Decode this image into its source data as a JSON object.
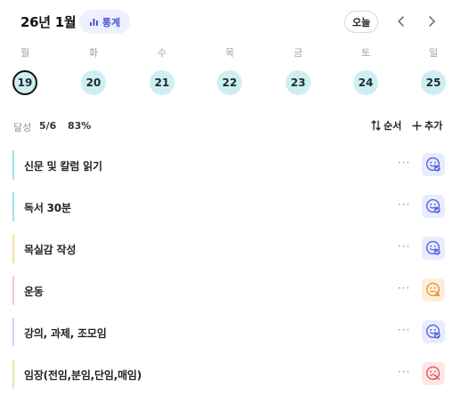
{
  "header": {
    "month_title": "26년 1월",
    "stats_label": "통계",
    "today_label": "오늘",
    "prev_icon": "chevron-left-icon",
    "next_icon": "chevron-right-icon"
  },
  "week": {
    "days": [
      {
        "name": "월",
        "date": "19",
        "selected": true
      },
      {
        "name": "화",
        "date": "20",
        "selected": false
      },
      {
        "name": "수",
        "date": "21",
        "selected": false
      },
      {
        "name": "목",
        "date": "22",
        "selected": false
      },
      {
        "name": "금",
        "date": "23",
        "selected": false
      },
      {
        "name": "토",
        "date": "24",
        "selected": false
      },
      {
        "name": "일",
        "date": "25",
        "selected": false
      }
    ],
    "circle_color": "#cdeff2"
  },
  "summary": {
    "label": "달성",
    "count": "5/6",
    "percent": "83%",
    "order_label": "순서",
    "add_label": "추가"
  },
  "tasks": [
    {
      "title": "신문 및 칼럼 읽기",
      "bar_color": "#9fe3e6",
      "status": "done",
      "more": "···"
    },
    {
      "title": "독서 30분",
      "bar_color": "#9fe3e6",
      "status": "done",
      "more": "···"
    },
    {
      "title": "목실감 작성",
      "bar_color": "#f5dfa6",
      "status": "done",
      "more": "···"
    },
    {
      "title": "운동",
      "bar_color": "#f0c7dd",
      "status": "warning",
      "more": "···"
    },
    {
      "title": "강의, 과제, 조모임",
      "bar_color": "#cfd3f3",
      "status": "done",
      "more": "···"
    },
    {
      "title": "임장(전임,분임,단임,매임)",
      "bar_color": "#d5eea2",
      "status": "failed",
      "more": "···"
    }
  ],
  "status_styles": {
    "done": {
      "bg": "#e9ecfd",
      "color": "#5563e0",
      "icon": "smile-check-icon"
    },
    "warning": {
      "bg": "#fdeed9",
      "color": "#e39a3b",
      "icon": "neutral-alert-icon"
    },
    "failed": {
      "bg": "#fde6e6",
      "color": "#e05a5a",
      "icon": "sad-x-icon"
    }
  }
}
